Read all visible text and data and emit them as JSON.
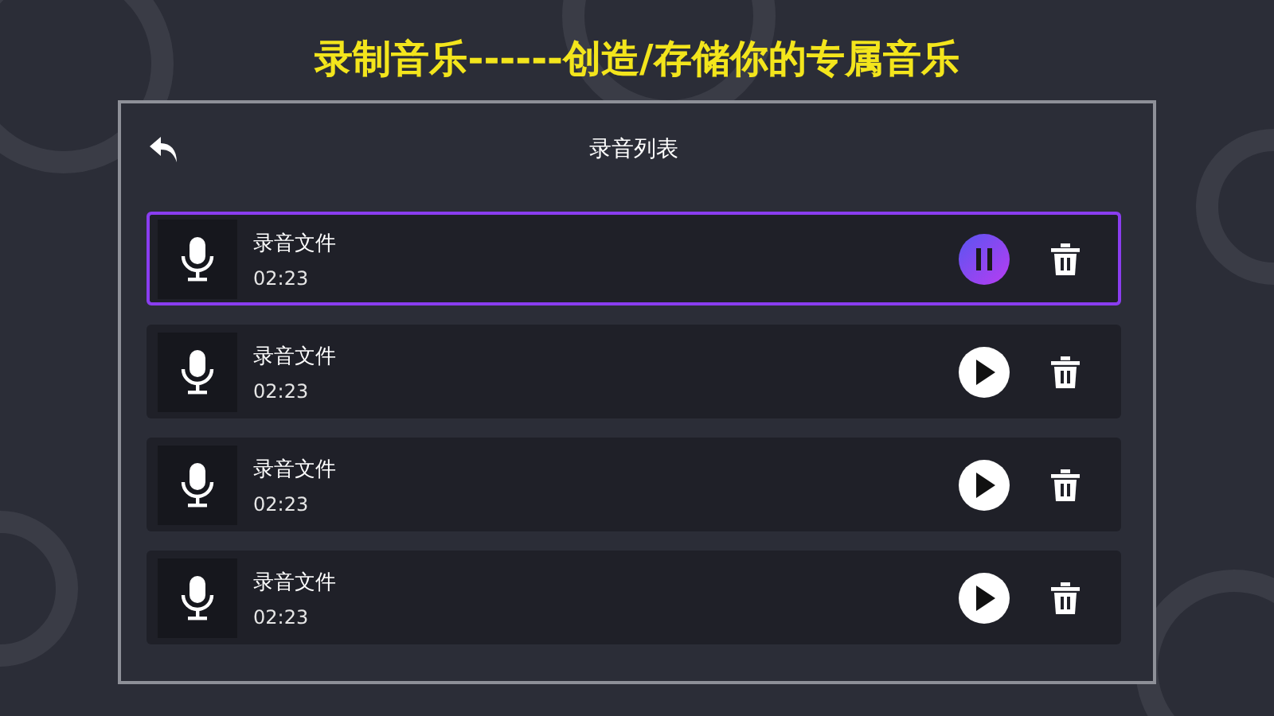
{
  "headline": "录制音乐------创造/存储你的专属音乐",
  "panel": {
    "title": "录音列表"
  },
  "recordings": [
    {
      "name": "录音文件",
      "duration": "02:23",
      "playing": true
    },
    {
      "name": "录音文件",
      "duration": "02:23",
      "playing": false
    },
    {
      "name": "录音文件",
      "duration": "02:23",
      "playing": false
    },
    {
      "name": "录音文件",
      "duration": "02:23",
      "playing": false
    }
  ]
}
